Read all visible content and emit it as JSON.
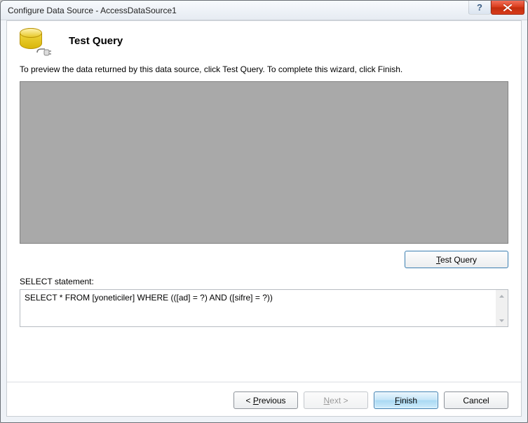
{
  "window": {
    "title": "Configure Data Source - AccessDataSource1"
  },
  "header": {
    "title": "Test Query"
  },
  "instruction": "To preview the data returned by this data source, click Test Query. To complete this wizard, click Finish.",
  "test_query_button": "Test Query",
  "select_label": "SELECT statement:",
  "select_statement": "SELECT * FROM [yoneticiler] WHERE (([ad] = ?) AND ([sifre] = ?))",
  "buttons": {
    "previous_full": "< Previous",
    "next_full": "Next >",
    "finish": "Finish",
    "cancel": "Cancel"
  }
}
